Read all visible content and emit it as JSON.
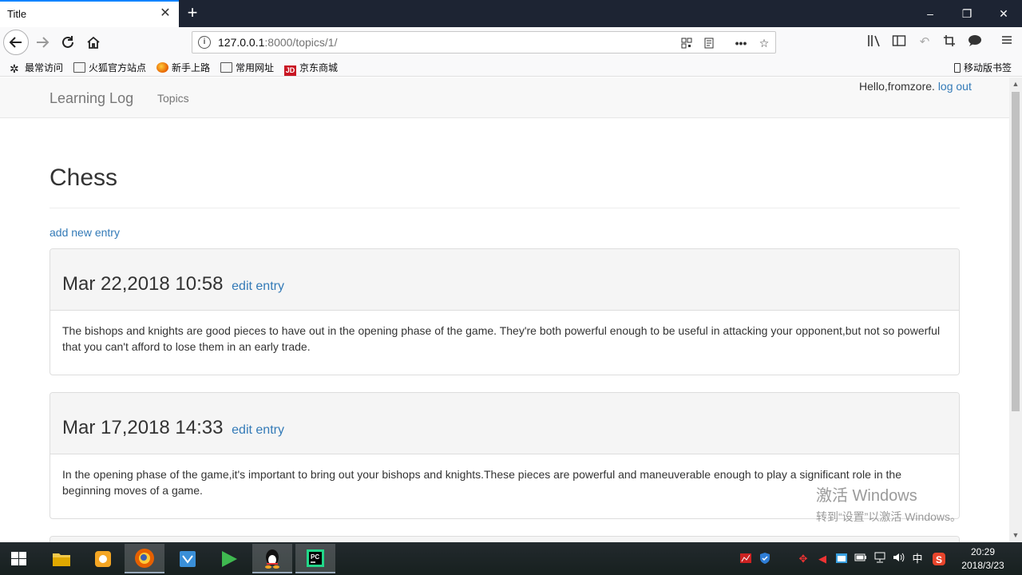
{
  "browser": {
    "tab_title": "Title",
    "tab_close": "✕",
    "new_tab": "+",
    "url_host": "127.0.0.1",
    "url_rest": ":8000/topics/1/",
    "window_controls": [
      "–",
      "❐",
      "✕"
    ],
    "bookmarks": [
      {
        "label": "最常访问",
        "icon": "gear-icon"
      },
      {
        "label": "火狐官方站点",
        "icon": "folder-icon"
      },
      {
        "label": "新手上路",
        "icon": "firefox-icon"
      },
      {
        "label": "常用网址",
        "icon": "folder-icon"
      },
      {
        "label": "京东商城",
        "icon": "jd-icon"
      }
    ],
    "jd_badge": "JD",
    "mobile_bookmarks": "移动版书签"
  },
  "site": {
    "brand": "Learning Log",
    "nav_topics": "Topics",
    "hello": "Hello,fromzore.",
    "logout": "log out"
  },
  "topic": {
    "title": "Chess",
    "add_entry": "add new entry"
  },
  "entries": [
    {
      "date": "Mar 22,2018 10:58",
      "edit": "edit entry",
      "text": "The bishops and knights are good pieces to have out in the opening phase of the game. They're both powerful enough to be useful in attacking your opponent,but not so powerful that you can't afford to lose them in an early trade."
    },
    {
      "date": "Mar 17,2018 14:33",
      "edit": "edit entry",
      "text": "In the opening phase of the game,it's important to bring out your bishops and knights.These pieces are powerful and maneuverable enough to play a significant role in the beginning moves of a game."
    }
  ],
  "watermark": {
    "line1": "激活 Windows",
    "line2": "转到“设置”以激活 Windows。"
  },
  "taskbar": {
    "time": "20:29",
    "date": "2018/3/23",
    "ime": "中"
  },
  "colors": {
    "link": "#337ab7",
    "titlebar": "#1d2433",
    "tab_accent": "#0a84ff"
  }
}
